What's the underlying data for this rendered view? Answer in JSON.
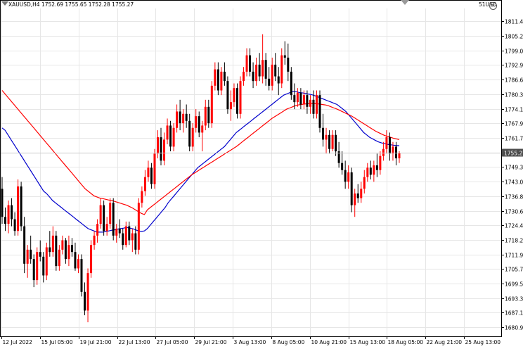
{
  "header": {
    "title": "XAUUSD,H4",
    "ohlc": "1752.69 1755.65 1752.28 1755.27",
    "account": "51USD"
  },
  "chart_data": {
    "type": "candlestick",
    "symbol": "XAUUSD",
    "timeframe": "H4",
    "ylim": [
      1677.0,
      1817.0
    ],
    "y_ticks": [
      "1811.45",
      "1805.25",
      "1799.00",
      "1792.90",
      "1786.60",
      "1780.35",
      "1774.15",
      "1767.95",
      "1761.70",
      "1755.27",
      "1749.30",
      "1743.05",
      "1736.85",
      "1730.60",
      "1724.40",
      "1718.20",
      "1711.95",
      "1705.75",
      "1699.55",
      "1693.30",
      "1687.10",
      "1680.90"
    ],
    "x_labels": [
      "12 Jul 2022",
      "15 Jul 05:00",
      "19 Jul 21:00",
      "22 Jul 13:00",
      "27 Jul 05:00",
      "29 Jul 21:00",
      "3 Aug 13:00",
      "8 Aug 05:00",
      "10 Aug 21:00",
      "15 Aug 13:00",
      "18 Aug 05:00",
      "22 Aug 21:00",
      "25 Aug 13:00"
    ],
    "current_price": 1755.27,
    "bull_color": "#ff0000",
    "bear_color": "#000000",
    "ma_series": [
      {
        "color": "#0000cc",
        "values": [
          1766,
          1765,
          1763,
          1761,
          1759,
          1757,
          1755,
          1753,
          1751,
          1749,
          1747,
          1745,
          1743,
          1741,
          1739,
          1738,
          1736.5,
          1735,
          1734,
          1733,
          1732,
          1731,
          1730,
          1729,
          1728,
          1727,
          1726,
          1725,
          1724,
          1723,
          1722.5,
          1722,
          1721.5,
          1721.5,
          1721.5,
          1721.8,
          1722,
          1722.3,
          1722.5,
          1722.8,
          1723,
          1723.2,
          1723.5,
          1723.2,
          1723,
          1722.5,
          1722,
          1721.8,
          1722,
          1723,
          1724.5,
          1726,
          1727.5,
          1729,
          1730.5,
          1732,
          1734,
          1735.5,
          1737,
          1738.5,
          1740,
          1741.5,
          1743,
          1744.5,
          1746,
          1747.5,
          1749,
          1750,
          1751,
          1752,
          1753,
          1754,
          1755,
          1756,
          1757,
          1758,
          1759.5,
          1761,
          1762.5,
          1764,
          1765,
          1766,
          1767,
          1768,
          1769,
          1770,
          1771,
          1772,
          1773,
          1774,
          1775,
          1776,
          1777,
          1778,
          1779,
          1780,
          1780.5,
          1781,
          1781.5,
          1781.5,
          1781.2,
          1781,
          1780.8,
          1780.5,
          1780.3,
          1780,
          1779.5,
          1779,
          1778.5,
          1778,
          1777.5,
          1777,
          1776.5,
          1776,
          1775,
          1774,
          1773,
          1771.5,
          1770,
          1768.5,
          1767,
          1765.5,
          1764,
          1763,
          1762,
          1761.3,
          1760.6,
          1760,
          1759.6,
          1759.3,
          1759,
          1758.8,
          1758.6,
          1758.5,
          1758.4
        ]
      },
      {
        "color": "#ff0000",
        "values": [
          1782,
          1780.5,
          1779,
          1777.5,
          1776,
          1774.5,
          1773,
          1771.5,
          1770,
          1768.5,
          1767,
          1765.5,
          1764,
          1762.5,
          1761,
          1759.5,
          1758,
          1756.5,
          1755,
          1753.5,
          1752,
          1750.5,
          1749,
          1747.5,
          1746,
          1744.5,
          1743,
          1741.5,
          1740,
          1739,
          1738,
          1737,
          1736.5,
          1736,
          1735.8,
          1735.5,
          1735.2,
          1735,
          1734.6,
          1734.2,
          1733.8,
          1733.4,
          1733,
          1732.4,
          1731.8,
          1731,
          1730.2,
          1729.5,
          1729,
          1731,
          1732,
          1733,
          1734,
          1735,
          1736,
          1737,
          1738,
          1739,
          1740,
          1741,
          1742,
          1743,
          1744,
          1745,
          1746,
          1746.8,
          1747.6,
          1748.4,
          1749.2,
          1750,
          1750.8,
          1751.6,
          1752.4,
          1753.2,
          1754,
          1754.8,
          1755.6,
          1756.4,
          1757.2,
          1758,
          1759,
          1760,
          1761,
          1762,
          1763,
          1764,
          1765,
          1766,
          1767,
          1768,
          1769,
          1770,
          1770.8,
          1771.6,
          1772.4,
          1773.2,
          1774,
          1774.5,
          1775,
          1775.5,
          1775.8,
          1776,
          1776.2,
          1776.3,
          1776.4,
          1776.4,
          1776.3,
          1776.2,
          1776,
          1775.8,
          1775.5,
          1775,
          1774.5,
          1774,
          1773.4,
          1772.8,
          1772.2,
          1771.6,
          1771,
          1770.2,
          1769.4,
          1768.6,
          1767.8,
          1767,
          1766.2,
          1765.4,
          1764.6,
          1764,
          1763.4,
          1762.8,
          1762.4,
          1762,
          1761.6,
          1761.3,
          1761
        ]
      }
    ],
    "candles_ohlc": [
      [
        1740,
        1745,
        1725,
        1728
      ],
      [
        1728,
        1732,
        1722,
        1725
      ],
      [
        1725,
        1735,
        1721,
        1733
      ],
      [
        1733,
        1736,
        1724,
        1727
      ],
      [
        1727,
        1730,
        1720,
        1722
      ],
      [
        1722,
        1744,
        1720,
        1741
      ],
      [
        1741,
        1743,
        1722,
        1724
      ],
      [
        1724,
        1728,
        1704,
        1708
      ],
      [
        1708,
        1716,
        1702,
        1714
      ],
      [
        1714,
        1720,
        1708,
        1710
      ],
      [
        1710,
        1712,
        1698,
        1701
      ],
      [
        1701,
        1715,
        1699,
        1713
      ],
      [
        1713,
        1718,
        1709,
        1711
      ],
      [
        1711,
        1713,
        1700,
        1703
      ],
      [
        1703,
        1717,
        1701,
        1715
      ],
      [
        1715,
        1722,
        1711,
        1713
      ],
      [
        1713,
        1724,
        1711,
        1720
      ],
      [
        1720,
        1722,
        1705,
        1707
      ],
      [
        1707,
        1716,
        1705,
        1714
      ],
      [
        1714,
        1720,
        1712,
        1718
      ],
      [
        1718,
        1719,
        1708,
        1710
      ],
      [
        1710,
        1720,
        1707,
        1716
      ],
      [
        1716,
        1719,
        1711,
        1713
      ],
      [
        1713,
        1717,
        1705,
        1706
      ],
      [
        1706,
        1712,
        1704,
        1710
      ],
      [
        1710,
        1712,
        1694,
        1696
      ],
      [
        1696,
        1700,
        1686,
        1688
      ],
      [
        1688,
        1706,
        1683,
        1704
      ],
      [
        1704,
        1718,
        1702,
        1716
      ],
      [
        1716,
        1722,
        1714,
        1720
      ],
      [
        1720,
        1727,
        1717,
        1725
      ],
      [
        1725,
        1736,
        1723,
        1733
      ],
      [
        1733,
        1735,
        1720,
        1722
      ],
      [
        1722,
        1728,
        1720,
        1725
      ],
      [
        1725,
        1736,
        1723,
        1734
      ],
      [
        1734,
        1736,
        1718,
        1720
      ],
      [
        1720,
        1725,
        1717,
        1723
      ],
      [
        1723,
        1727,
        1719,
        1721
      ],
      [
        1721,
        1723,
        1714,
        1716
      ],
      [
        1716,
        1726,
        1715,
        1724
      ],
      [
        1724,
        1726,
        1716,
        1718
      ],
      [
        1718,
        1723,
        1713,
        1721
      ],
      [
        1721,
        1724,
        1712,
        1714
      ],
      [
        1714,
        1736,
        1712,
        1734
      ],
      [
        1734,
        1741,
        1732,
        1739
      ],
      [
        1739,
        1748,
        1737,
        1745
      ],
      [
        1745,
        1752,
        1743,
        1749
      ],
      [
        1749,
        1751,
        1740,
        1742
      ],
      [
        1742,
        1757,
        1740,
        1755
      ],
      [
        1755,
        1765,
        1753,
        1762
      ],
      [
        1762,
        1766,
        1750,
        1752
      ],
      [
        1752,
        1764,
        1750,
        1761
      ],
      [
        1761,
        1770,
        1759,
        1767
      ],
      [
        1767,
        1769,
        1756,
        1758
      ],
      [
        1758,
        1768,
        1756,
        1766
      ],
      [
        1766,
        1776,
        1764,
        1773
      ],
      [
        1773,
        1778,
        1765,
        1768
      ],
      [
        1768,
        1774,
        1764,
        1772
      ],
      [
        1772,
        1776,
        1766,
        1769
      ],
      [
        1769,
        1772,
        1756,
        1758
      ],
      [
        1758,
        1768,
        1756,
        1766
      ],
      [
        1766,
        1774,
        1764,
        1771
      ],
      [
        1771,
        1773,
        1762,
        1764
      ],
      [
        1764,
        1769,
        1756,
        1767
      ],
      [
        1767,
        1778,
        1765,
        1775
      ],
      [
        1775,
        1778,
        1766,
        1768
      ],
      [
        1768,
        1786,
        1766,
        1784
      ],
      [
        1784,
        1794,
        1782,
        1791
      ],
      [
        1791,
        1794,
        1780,
        1782
      ],
      [
        1782,
        1792,
        1780,
        1790
      ],
      [
        1790,
        1794,
        1784,
        1786
      ],
      [
        1786,
        1788,
        1772,
        1774
      ],
      [
        1774,
        1782,
        1769,
        1777
      ],
      [
        1777,
        1785,
        1775,
        1783
      ],
      [
        1783,
        1785,
        1770,
        1772
      ],
      [
        1772,
        1788,
        1770,
        1786
      ],
      [
        1786,
        1792,
        1784,
        1790
      ],
      [
        1790,
        1800,
        1788,
        1797
      ],
      [
        1797,
        1800,
        1788,
        1790
      ],
      [
        1790,
        1794,
        1783,
        1786
      ],
      [
        1786,
        1796,
        1784,
        1793
      ],
      [
        1793,
        1798,
        1786,
        1788
      ],
      [
        1788,
        1806,
        1785,
        1795
      ],
      [
        1795,
        1798,
        1784,
        1787
      ],
      [
        1787,
        1792,
        1782,
        1784
      ],
      [
        1784,
        1796,
        1782,
        1793
      ],
      [
        1793,
        1798,
        1786,
        1788
      ],
      [
        1788,
        1792,
        1780,
        1785
      ],
      [
        1785,
        1800,
        1783,
        1797
      ],
      [
        1797,
        1803,
        1793,
        1796
      ],
      [
        1796,
        1802,
        1786,
        1790
      ],
      [
        1790,
        1792,
        1778,
        1780
      ],
      [
        1780,
        1785,
        1774,
        1777
      ],
      [
        1777,
        1783,
        1775,
        1781
      ],
      [
        1781,
        1783,
        1774,
        1776
      ],
      [
        1776,
        1782,
        1774,
        1780
      ],
      [
        1780,
        1782,
        1772,
        1775
      ],
      [
        1775,
        1780,
        1772,
        1778
      ],
      [
        1778,
        1782,
        1770,
        1772
      ],
      [
        1772,
        1782,
        1770,
        1780
      ],
      [
        1780,
        1782,
        1764,
        1766
      ],
      [
        1766,
        1772,
        1758,
        1761
      ],
      [
        1761,
        1766,
        1755,
        1763
      ],
      [
        1763,
        1765,
        1755,
        1757
      ],
      [
        1757,
        1765,
        1756,
        1763
      ],
      [
        1763,
        1765,
        1754,
        1756
      ],
      [
        1756,
        1760,
        1749,
        1751
      ],
      [
        1751,
        1756,
        1746,
        1748
      ],
      [
        1748,
        1752,
        1740,
        1743
      ],
      [
        1743,
        1750,
        1740,
        1747
      ],
      [
        1747,
        1749,
        1730,
        1733
      ],
      [
        1733,
        1740,
        1728,
        1738
      ],
      [
        1738,
        1742,
        1734,
        1736
      ],
      [
        1736,
        1743,
        1734,
        1740
      ],
      [
        1740,
        1748,
        1738,
        1745
      ],
      [
        1745,
        1751,
        1743,
        1749
      ],
      [
        1749,
        1752,
        1744,
        1746
      ],
      [
        1746,
        1752,
        1743,
        1750
      ],
      [
        1750,
        1755,
        1745,
        1748
      ],
      [
        1748,
        1756,
        1746,
        1754
      ],
      [
        1754,
        1760,
        1752,
        1757
      ],
      [
        1757,
        1765,
        1755,
        1762
      ],
      [
        1762,
        1764,
        1752,
        1755
      ],
      [
        1755,
        1760,
        1752,
        1758
      ],
      [
        1758,
        1760,
        1750,
        1753
      ],
      [
        1753,
        1756,
        1751,
        1755.27
      ]
    ]
  },
  "axis": {
    "y": [
      "1811.45",
      "1805.25",
      "1799.00",
      "1792.90",
      "1786.60",
      "1780.35",
      "1774.15",
      "1767.95",
      "1761.70",
      "1755.27",
      "1749.30",
      "1743.05",
      "1736.85",
      "1730.60",
      "1724.40",
      "1718.20",
      "1711.95",
      "1705.75",
      "1699.55",
      "1693.30",
      "1687.10",
      "1680.90"
    ],
    "x": [
      "12 Jul 2022",
      "15 Jul 05:00",
      "19 Jul 21:00",
      "22 Jul 13:00",
      "27 Jul 05:00",
      "29 Jul 21:00",
      "3 Aug 13:00",
      "8 Aug 05:00",
      "10 Aug 21:00",
      "15 Aug 13:00",
      "18 Aug 05:00",
      "22 Aug 21:00",
      "25 Aug 13:00"
    ]
  },
  "colors": {
    "grid": "#e6e6e6",
    "axis": "#000000",
    "price_box": "#4d4d4d"
  },
  "icons": {
    "close": "close-icon",
    "scroll_marker": "scroll-marker-icon",
    "menu": "menu-triangle-icon"
  }
}
